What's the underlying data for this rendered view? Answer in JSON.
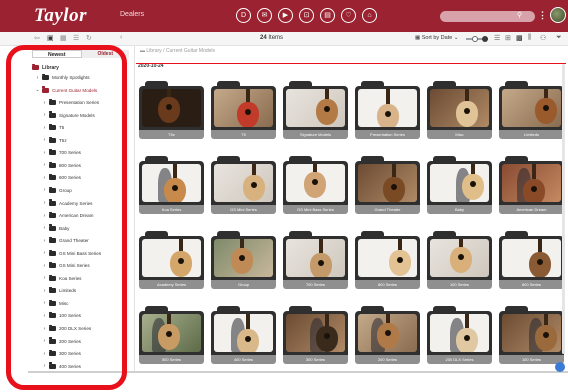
{
  "app": {
    "logo": "Taylor",
    "section": "Dealers"
  },
  "header_icons": [
    "dealer-circle-icon",
    "message-circle-icon",
    "play-circle-icon",
    "cart-circle-icon",
    "document-circle-icon",
    "heart-circle-icon",
    "house-circle-icon"
  ],
  "toolbar": {
    "count_number": "24",
    "count_suffix": "Items",
    "sort_label": "Sort by Date"
  },
  "sidebar": {
    "sort_newest": "Newest",
    "sort_oldest": "Oldest",
    "library": "Library",
    "items": [
      {
        "label": "Monthly Spotlights",
        "level": 1,
        "expanded": false
      },
      {
        "label": "Current Guitar Models",
        "level": 1,
        "expanded": true,
        "selected": true
      },
      {
        "label": "Presentation Series",
        "level": 2
      },
      {
        "label": "Signature Models",
        "level": 2
      },
      {
        "label": "T5",
        "level": 2
      },
      {
        "label": "T5z",
        "level": 2
      },
      {
        "label": "700 Series",
        "level": 2
      },
      {
        "label": "800 Series",
        "level": 2
      },
      {
        "label": "600 Series",
        "level": 2
      },
      {
        "label": "Group",
        "level": 2
      },
      {
        "label": "Academy Series",
        "level": 2
      },
      {
        "label": "American Dream",
        "level": 2
      },
      {
        "label": "Baby",
        "level": 2
      },
      {
        "label": "Grand Theater",
        "level": 2
      },
      {
        "label": "GS Mini Bass Series",
        "level": 2
      },
      {
        "label": "GS Mini Series",
        "level": 2
      },
      {
        "label": "Koa Series",
        "level": 2
      },
      {
        "label": "Limiteds",
        "level": 2
      },
      {
        "label": "Misc",
        "level": 2
      },
      {
        "label": "100 Series",
        "level": 2
      },
      {
        "label": "200 DLX Series",
        "level": 2
      },
      {
        "label": "200 Series",
        "level": 2
      },
      {
        "label": "300 Series",
        "level": 2
      },
      {
        "label": "400 Series",
        "level": 2
      }
    ]
  },
  "main": {
    "breadcrumb": "Library / Current Guitar Models",
    "date": "2020-10-24",
    "cards": [
      "T5z",
      "T5",
      "Signature Models",
      "Presentation Series",
      "Misc",
      "Limiteds",
      "Koa Series",
      "GS Mini Series",
      "GS Mini Bass Series",
      "Grand Theater",
      "Baby",
      "American Dream",
      "Academy Series",
      "Group",
      "700 Series",
      "800 Series",
      "100 Series",
      "600 Series",
      "500 Series",
      "400 Series",
      "300 Series",
      "200 Series",
      "200 DLX Series",
      "100 Series"
    ]
  },
  "colors": {
    "brand": "#9b2230",
    "highlight": "#e8101a",
    "label_bar": "#8f8f8f",
    "thumb_frame": "#2f2f2f"
  }
}
